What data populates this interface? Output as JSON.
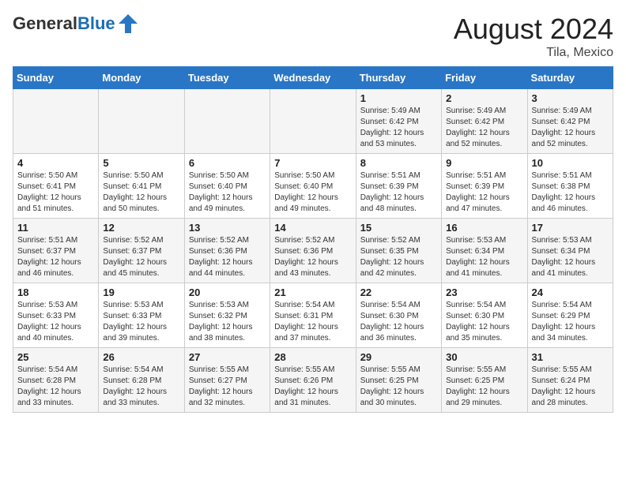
{
  "header": {
    "logo_general": "General",
    "logo_blue": "Blue",
    "month_title": "August 2024",
    "location": "Tila, Mexico"
  },
  "days_of_week": [
    "Sunday",
    "Monday",
    "Tuesday",
    "Wednesday",
    "Thursday",
    "Friday",
    "Saturday"
  ],
  "weeks": [
    [
      {
        "num": "",
        "sunrise": "",
        "sunset": "",
        "daylight": ""
      },
      {
        "num": "",
        "sunrise": "",
        "sunset": "",
        "daylight": ""
      },
      {
        "num": "",
        "sunrise": "",
        "sunset": "",
        "daylight": ""
      },
      {
        "num": "",
        "sunrise": "",
        "sunset": "",
        "daylight": ""
      },
      {
        "num": "1",
        "sunrise": "Sunrise: 5:49 AM",
        "sunset": "Sunset: 6:42 PM",
        "daylight": "Daylight: 12 hours and 53 minutes."
      },
      {
        "num": "2",
        "sunrise": "Sunrise: 5:49 AM",
        "sunset": "Sunset: 6:42 PM",
        "daylight": "Daylight: 12 hours and 52 minutes."
      },
      {
        "num": "3",
        "sunrise": "Sunrise: 5:49 AM",
        "sunset": "Sunset: 6:42 PM",
        "daylight": "Daylight: 12 hours and 52 minutes."
      }
    ],
    [
      {
        "num": "4",
        "sunrise": "Sunrise: 5:50 AM",
        "sunset": "Sunset: 6:41 PM",
        "daylight": "Daylight: 12 hours and 51 minutes."
      },
      {
        "num": "5",
        "sunrise": "Sunrise: 5:50 AM",
        "sunset": "Sunset: 6:41 PM",
        "daylight": "Daylight: 12 hours and 50 minutes."
      },
      {
        "num": "6",
        "sunrise": "Sunrise: 5:50 AM",
        "sunset": "Sunset: 6:40 PM",
        "daylight": "Daylight: 12 hours and 49 minutes."
      },
      {
        "num": "7",
        "sunrise": "Sunrise: 5:50 AM",
        "sunset": "Sunset: 6:40 PM",
        "daylight": "Daylight: 12 hours and 49 minutes."
      },
      {
        "num": "8",
        "sunrise": "Sunrise: 5:51 AM",
        "sunset": "Sunset: 6:39 PM",
        "daylight": "Daylight: 12 hours and 48 minutes."
      },
      {
        "num": "9",
        "sunrise": "Sunrise: 5:51 AM",
        "sunset": "Sunset: 6:39 PM",
        "daylight": "Daylight: 12 hours and 47 minutes."
      },
      {
        "num": "10",
        "sunrise": "Sunrise: 5:51 AM",
        "sunset": "Sunset: 6:38 PM",
        "daylight": "Daylight: 12 hours and 46 minutes."
      }
    ],
    [
      {
        "num": "11",
        "sunrise": "Sunrise: 5:51 AM",
        "sunset": "Sunset: 6:37 PM",
        "daylight": "Daylight: 12 hours and 46 minutes."
      },
      {
        "num": "12",
        "sunrise": "Sunrise: 5:52 AM",
        "sunset": "Sunset: 6:37 PM",
        "daylight": "Daylight: 12 hours and 45 minutes."
      },
      {
        "num": "13",
        "sunrise": "Sunrise: 5:52 AM",
        "sunset": "Sunset: 6:36 PM",
        "daylight": "Daylight: 12 hours and 44 minutes."
      },
      {
        "num": "14",
        "sunrise": "Sunrise: 5:52 AM",
        "sunset": "Sunset: 6:36 PM",
        "daylight": "Daylight: 12 hours and 43 minutes."
      },
      {
        "num": "15",
        "sunrise": "Sunrise: 5:52 AM",
        "sunset": "Sunset: 6:35 PM",
        "daylight": "Daylight: 12 hours and 42 minutes."
      },
      {
        "num": "16",
        "sunrise": "Sunrise: 5:53 AM",
        "sunset": "Sunset: 6:34 PM",
        "daylight": "Daylight: 12 hours and 41 minutes."
      },
      {
        "num": "17",
        "sunrise": "Sunrise: 5:53 AM",
        "sunset": "Sunset: 6:34 PM",
        "daylight": "Daylight: 12 hours and 41 minutes."
      }
    ],
    [
      {
        "num": "18",
        "sunrise": "Sunrise: 5:53 AM",
        "sunset": "Sunset: 6:33 PM",
        "daylight": "Daylight: 12 hours and 40 minutes."
      },
      {
        "num": "19",
        "sunrise": "Sunrise: 5:53 AM",
        "sunset": "Sunset: 6:33 PM",
        "daylight": "Daylight: 12 hours and 39 minutes."
      },
      {
        "num": "20",
        "sunrise": "Sunrise: 5:53 AM",
        "sunset": "Sunset: 6:32 PM",
        "daylight": "Daylight: 12 hours and 38 minutes."
      },
      {
        "num": "21",
        "sunrise": "Sunrise: 5:54 AM",
        "sunset": "Sunset: 6:31 PM",
        "daylight": "Daylight: 12 hours and 37 minutes."
      },
      {
        "num": "22",
        "sunrise": "Sunrise: 5:54 AM",
        "sunset": "Sunset: 6:30 PM",
        "daylight": "Daylight: 12 hours and 36 minutes."
      },
      {
        "num": "23",
        "sunrise": "Sunrise: 5:54 AM",
        "sunset": "Sunset: 6:30 PM",
        "daylight": "Daylight: 12 hours and 35 minutes."
      },
      {
        "num": "24",
        "sunrise": "Sunrise: 5:54 AM",
        "sunset": "Sunset: 6:29 PM",
        "daylight": "Daylight: 12 hours and 34 minutes."
      }
    ],
    [
      {
        "num": "25",
        "sunrise": "Sunrise: 5:54 AM",
        "sunset": "Sunset: 6:28 PM",
        "daylight": "Daylight: 12 hours and 33 minutes."
      },
      {
        "num": "26",
        "sunrise": "Sunrise: 5:54 AM",
        "sunset": "Sunset: 6:28 PM",
        "daylight": "Daylight: 12 hours and 33 minutes."
      },
      {
        "num": "27",
        "sunrise": "Sunrise: 5:55 AM",
        "sunset": "Sunset: 6:27 PM",
        "daylight": "Daylight: 12 hours and 32 minutes."
      },
      {
        "num": "28",
        "sunrise": "Sunrise: 5:55 AM",
        "sunset": "Sunset: 6:26 PM",
        "daylight": "Daylight: 12 hours and 31 minutes."
      },
      {
        "num": "29",
        "sunrise": "Sunrise: 5:55 AM",
        "sunset": "Sunset: 6:25 PM",
        "daylight": "Daylight: 12 hours and 30 minutes."
      },
      {
        "num": "30",
        "sunrise": "Sunrise: 5:55 AM",
        "sunset": "Sunset: 6:25 PM",
        "daylight": "Daylight: 12 hours and 29 minutes."
      },
      {
        "num": "31",
        "sunrise": "Sunrise: 5:55 AM",
        "sunset": "Sunset: 6:24 PM",
        "daylight": "Daylight: 12 hours and 28 minutes."
      }
    ]
  ]
}
